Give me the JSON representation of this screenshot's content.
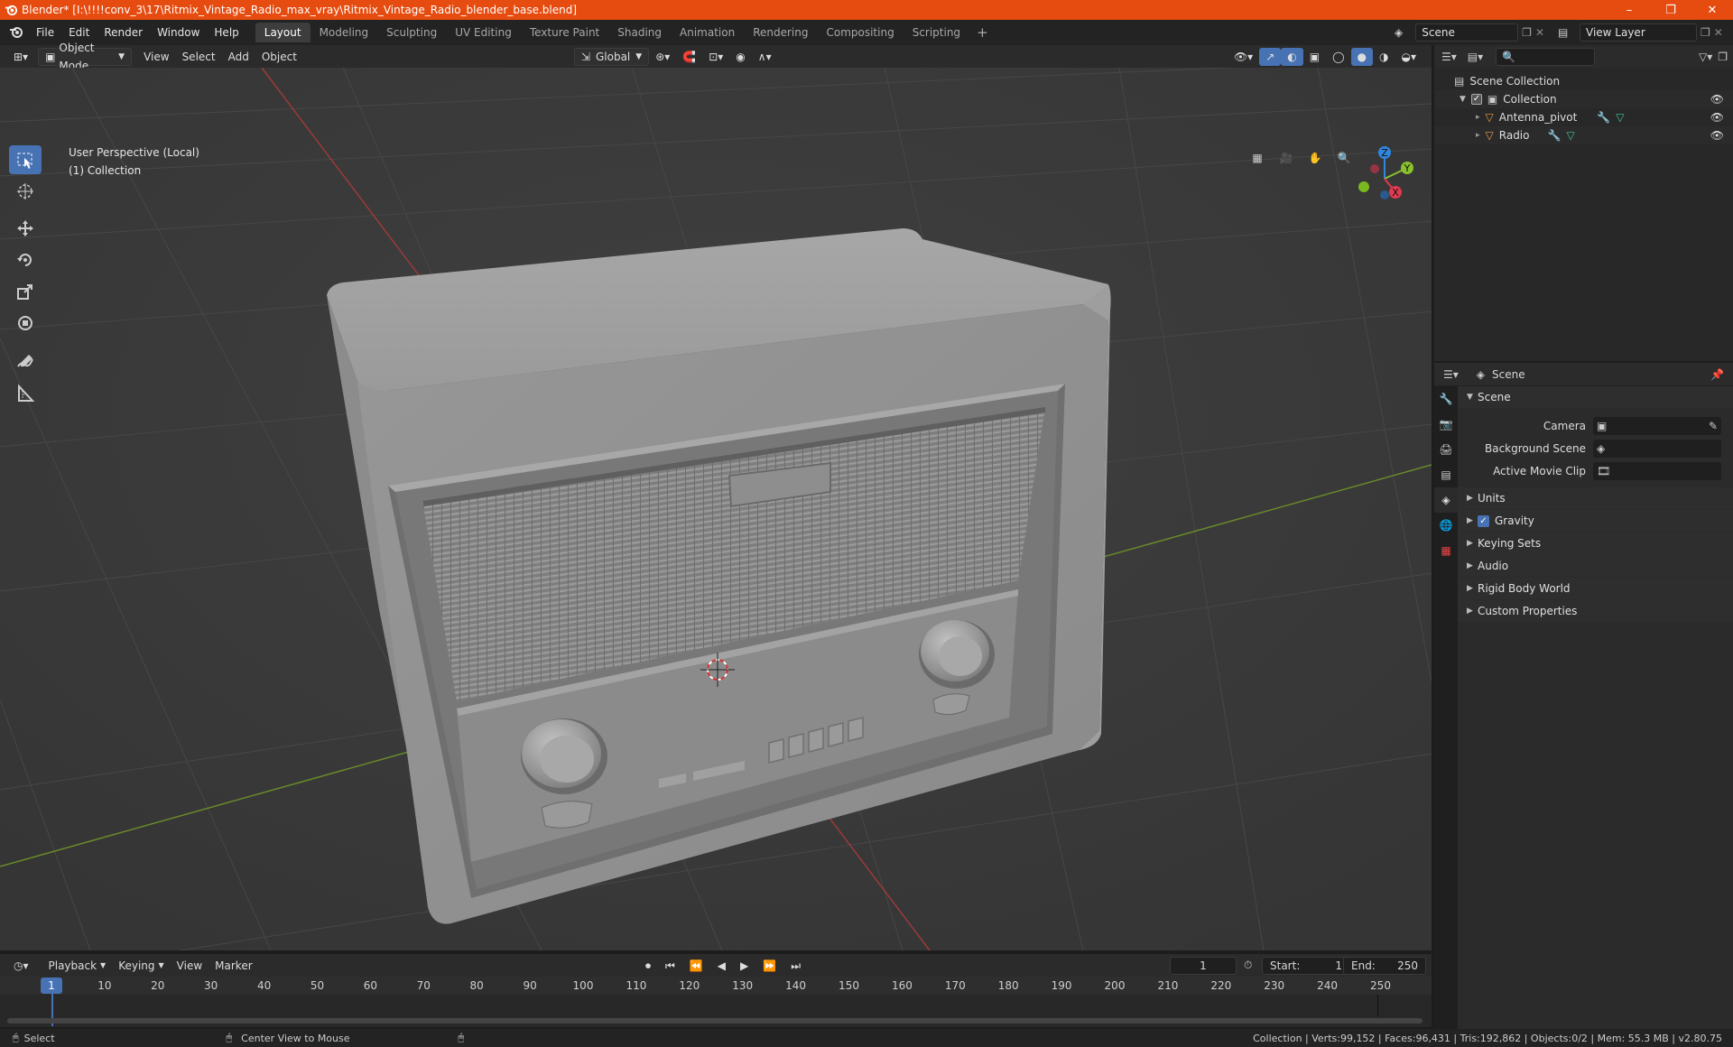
{
  "window": {
    "title": "Blender* [I:\\!!!!conv_3\\17\\Ritmix_Vintage_Radio_max_vray\\Ritmix_Vintage_Radio_blender_base.blend]",
    "minimize": "–",
    "maximize": "❐",
    "close": "✕"
  },
  "menu": [
    "File",
    "Edit",
    "Render",
    "Window",
    "Help"
  ],
  "workspaces": [
    "Layout",
    "Modeling",
    "Sculpting",
    "UV Editing",
    "Texture Paint",
    "Shading",
    "Animation",
    "Rendering",
    "Compositing",
    "Scripting"
  ],
  "active_workspace": "Layout",
  "scene_name": "Scene",
  "view_layer": "View Layer",
  "viewport_header": {
    "mode": "Object Mode",
    "menus": [
      "View",
      "Select",
      "Add",
      "Object"
    ],
    "orientation": "Global"
  },
  "viewport": {
    "perspective": "User Perspective (Local)",
    "collection": "(1) Collection",
    "gizmo_axes": {
      "z": "Z",
      "y": "Y",
      "x": "X"
    }
  },
  "outliner": {
    "root": "Scene Collection",
    "collection": "Collection",
    "objects": [
      "Antenna_pivot",
      "Radio"
    ]
  },
  "properties": {
    "header_title": "Scene",
    "panel_title": "Scene",
    "camera_label": "Camera",
    "background_scene_label": "Background Scene",
    "active_movie_clip_label": "Active Movie Clip",
    "sections": [
      "Units",
      "Gravity",
      "Keying Sets",
      "Audio",
      "Rigid Body World",
      "Custom Properties"
    ],
    "gravity_checked": true
  },
  "timeline": {
    "menus": [
      "Playback",
      "Keying",
      "View",
      "Marker"
    ],
    "current_frame": "1",
    "start_label": "Start:",
    "start": "1",
    "end_label": "End:",
    "end": "250",
    "ticks": [
      "10",
      "20",
      "30",
      "40",
      "50",
      "60",
      "70",
      "80",
      "90",
      "100",
      "110",
      "120",
      "130",
      "140",
      "150",
      "160",
      "170",
      "180",
      "190",
      "200",
      "210",
      "220",
      "230",
      "240",
      "250"
    ]
  },
  "statusbar": {
    "left_action": "Select",
    "middle_action": "Center View to Mouse",
    "stats": "Collection | Verts:99,152 | Faces:96,431 | Tris:192,862 | Objects:0/2 | Mem: 55.3 MB | v2.80.75"
  },
  "colors": {
    "accent": "#4772b3",
    "titlebar": "#e64b0f",
    "x_axis": "#e03a4e",
    "y_axis": "#8ac22c",
    "z_axis": "#2f86dd"
  }
}
